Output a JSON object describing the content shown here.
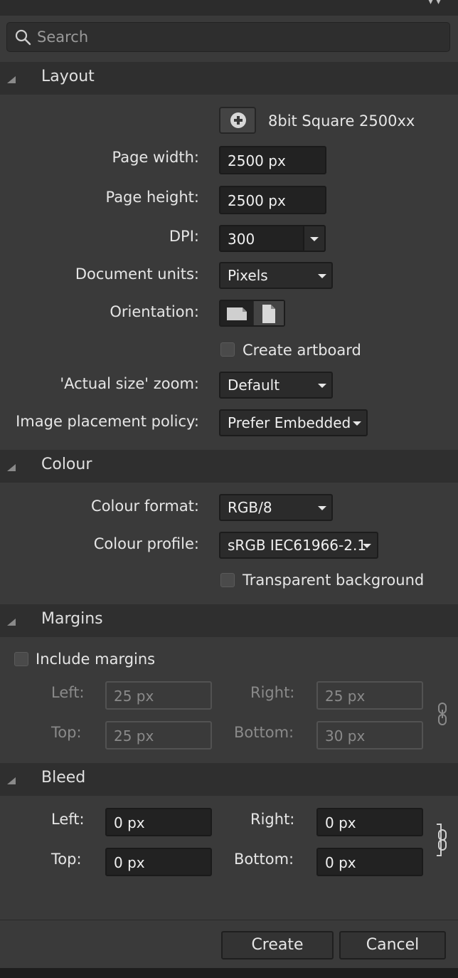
{
  "search": {
    "placeholder": "Search"
  },
  "layout": {
    "title": "Layout",
    "preset_name": "8bit Square 2500xx",
    "page_width_label": "Page width:",
    "page_width": "2500 px",
    "page_height_label": "Page height:",
    "page_height": "2500 px",
    "dpi_label": "DPI:",
    "dpi": "300",
    "units_label": "Document units:",
    "units": "Pixels",
    "orientation_label": "Orientation:",
    "artboard_label": "Create artboard",
    "zoom_label": "'Actual size' zoom:",
    "zoom": "Default",
    "placement_label": "Image placement policy:",
    "placement": "Prefer Embedded"
  },
  "colour": {
    "title": "Colour",
    "format_label": "Colour format:",
    "format": "RGB/8",
    "profile_label": "Colour profile:",
    "profile": "sRGB IEC61966-2.1",
    "transparent_label": "Transparent background"
  },
  "margins": {
    "title": "Margins",
    "include_label": "Include margins",
    "left_label": "Left:",
    "left": "25 px",
    "right_label": "Right:",
    "right": "25 px",
    "top_label": "Top:",
    "top": "25 px",
    "bottom_label": "Bottom:",
    "bottom": "30 px"
  },
  "bleed": {
    "title": "Bleed",
    "left_label": "Left:",
    "left": "0 px",
    "right_label": "Right:",
    "right": "0 px",
    "top_label": "Top:",
    "top": "0 px",
    "bottom_label": "Bottom:",
    "bottom": "0 px"
  },
  "footer": {
    "create_label": "Create",
    "cancel_label": "Cancel"
  },
  "icons": {
    "add_preset": "plus-circle-icon",
    "search": "magnifier-icon",
    "link": "chain-link-icon"
  }
}
